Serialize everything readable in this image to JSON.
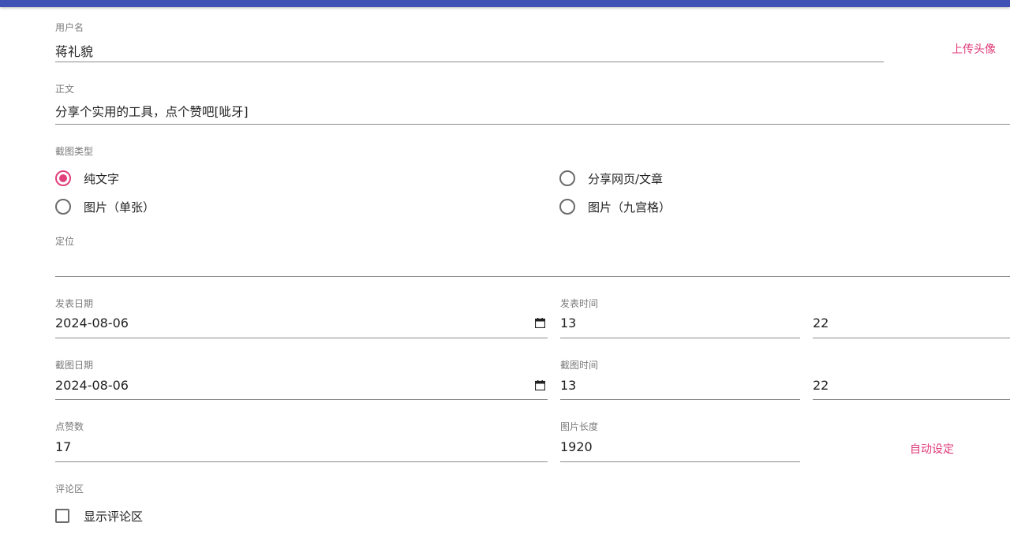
{
  "form": {
    "username": {
      "label": "用户名",
      "value": "蒋礼貌",
      "upload_label": "上传头像"
    },
    "body": {
      "label": "正文",
      "value": "分享个实用的工具，点个赞吧[呲牙]"
    },
    "screenshot_type": {
      "label": "截图类型",
      "options": [
        {
          "label": "纯文字",
          "checked": true
        },
        {
          "label": "分享网页/文章",
          "checked": false
        },
        {
          "label": "图片（单张）",
          "checked": false
        },
        {
          "label": "图片（九宫格）",
          "checked": false
        }
      ]
    },
    "location": {
      "label": "定位",
      "value": ""
    },
    "publish_date": {
      "label": "发表日期",
      "value": "2024-08-06"
    },
    "publish_time": {
      "label": "发表时间",
      "hour": "13",
      "minute": "22"
    },
    "capture_date": {
      "label": "截图日期",
      "value": "2024-08-06"
    },
    "capture_time": {
      "label": "截图时间",
      "hour": "13",
      "minute": "22"
    },
    "likes": {
      "label": "点赞数",
      "value": "17"
    },
    "image_length": {
      "label": "图片长度",
      "value": "1920",
      "auto_label": "自动设定"
    },
    "comments": {
      "label": "评论区",
      "checkbox_label": "显示评论区",
      "checked": false
    }
  },
  "colors": {
    "accent": "#e0417a",
    "appbar": "#3f51b5"
  }
}
